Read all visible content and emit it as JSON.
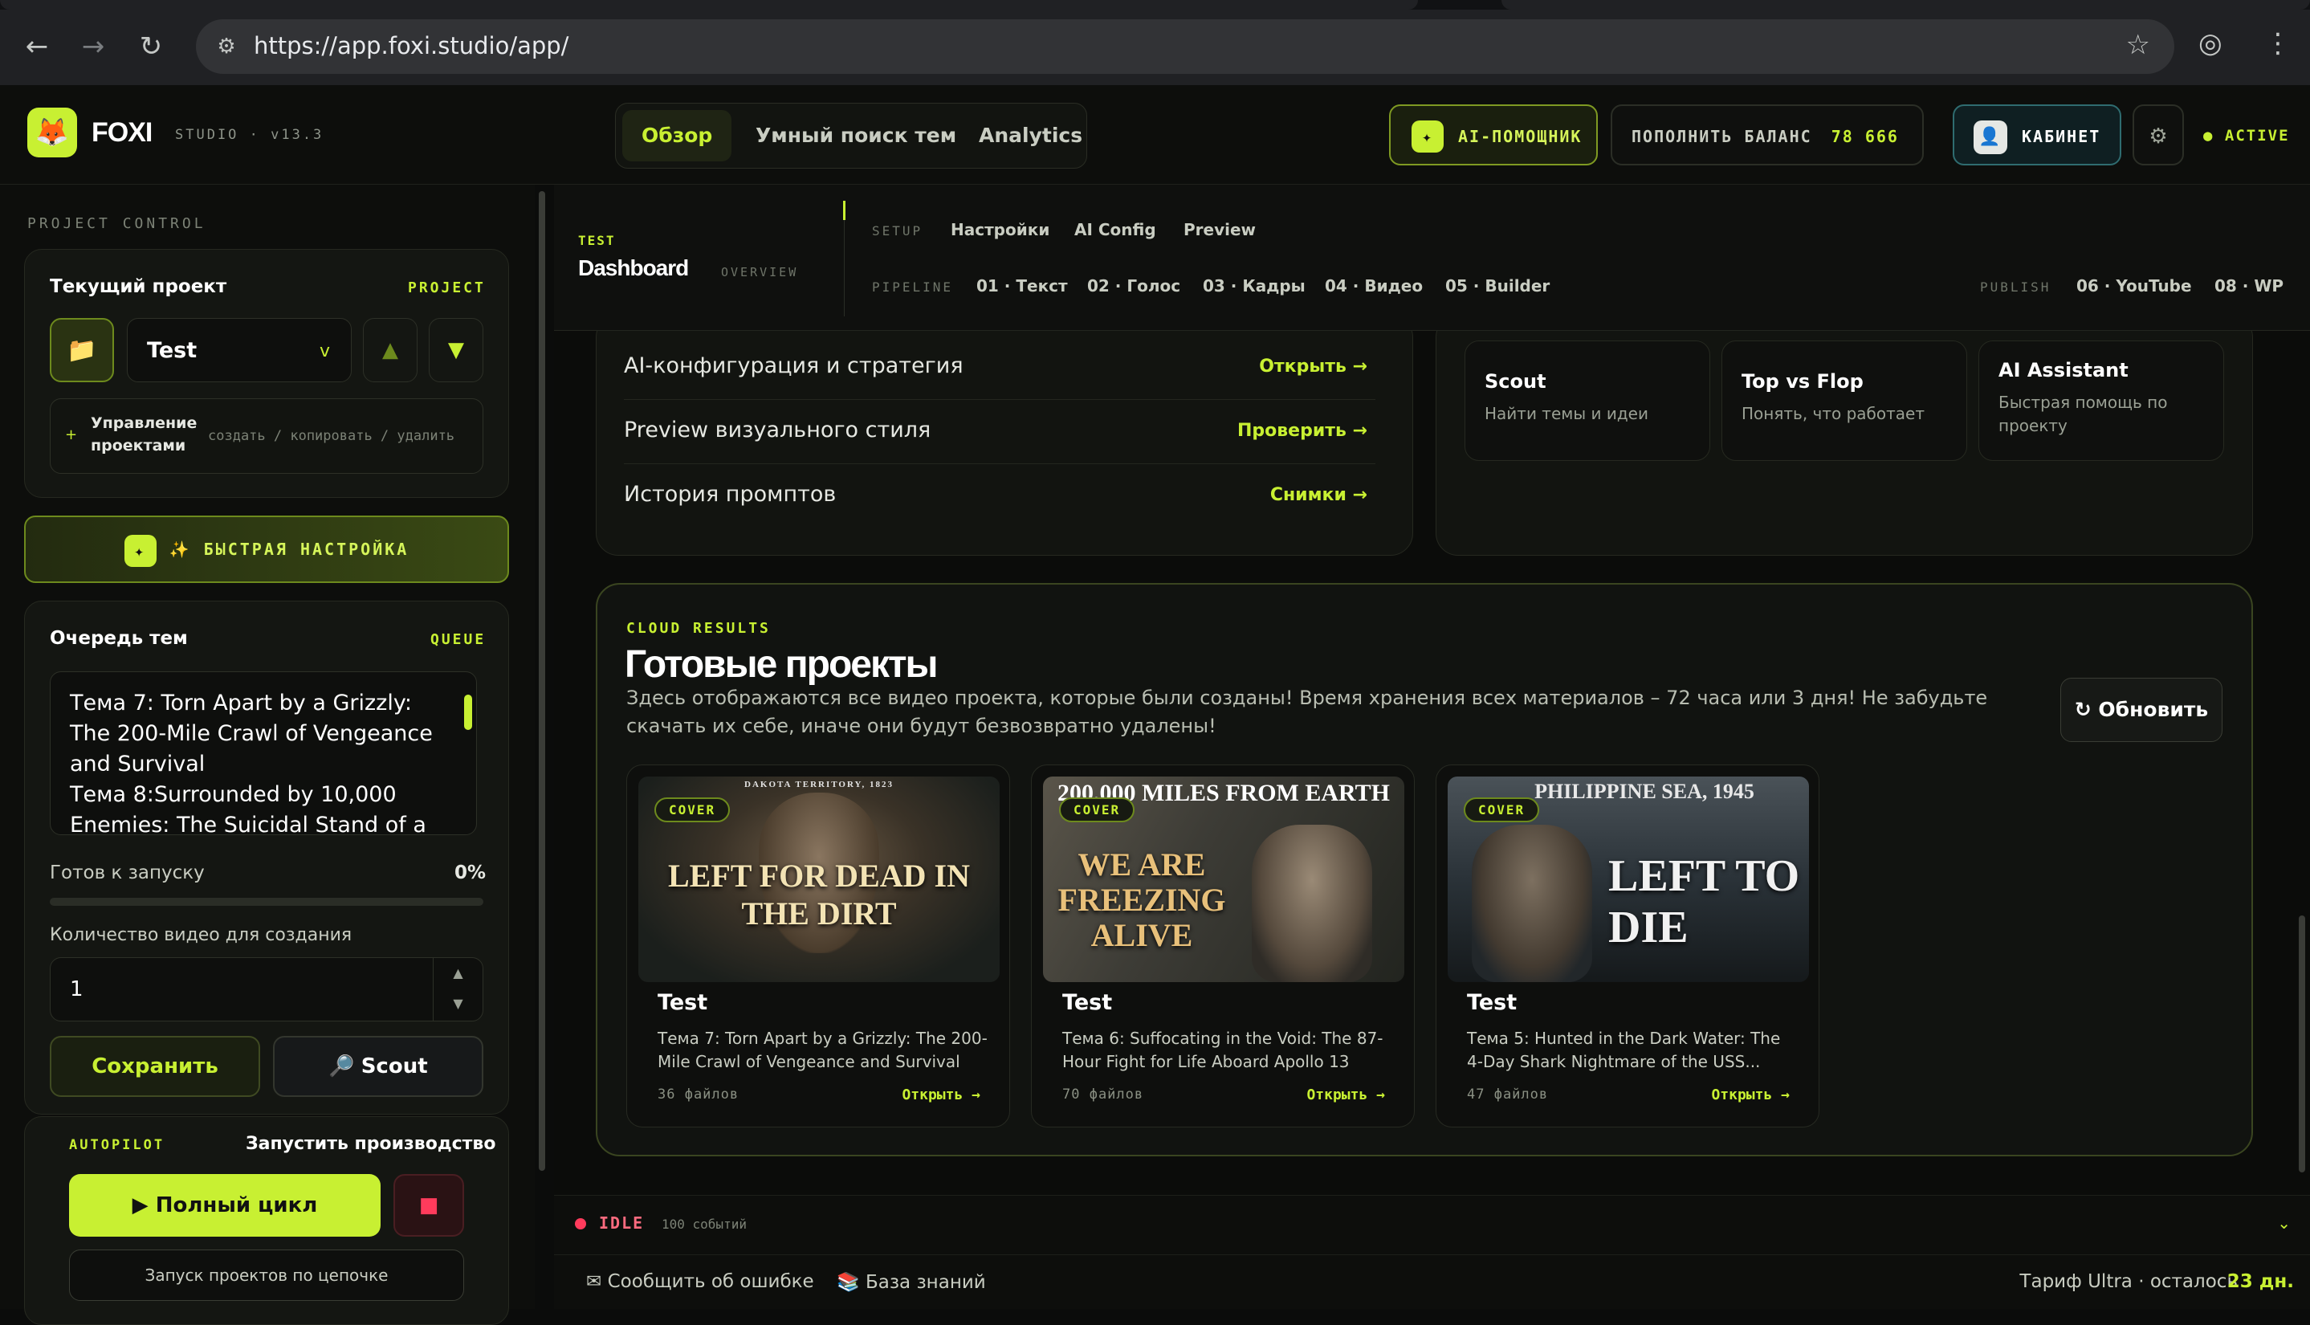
{
  "browser": {
    "url": "https://app.foxi.studio/app/"
  },
  "header": {
    "brand": "FOXI",
    "brand_sub": "STUDIO · v13.3",
    "nav_tabs": [
      {
        "label": "Обзор"
      },
      {
        "label": "Умный поиск тем"
      },
      {
        "label": "Analytics"
      }
    ],
    "ai_button": "AI-ПОМОЩНИК",
    "balance_label": "ПОПОЛНИТЬ БАЛАНС",
    "balance_value": "78 666 FX",
    "cabinet": "КАБИНЕТ",
    "status": "● ACTIVE",
    "accent_color": "#c8f032"
  },
  "sidebar": {
    "section_label": "PROJECT CONTROL",
    "current_project": {
      "title": "Текущий проект",
      "tag": "PROJECT",
      "selected": "Test",
      "manage_label": "Управление проектами",
      "manage_actions": "создать / копировать / удалить"
    },
    "quick_setup": "✨ БЫСТРАЯ НАСТРОЙКА",
    "queue": {
      "title": "Очередь тем",
      "tag": "QUEUE",
      "text": "Тема 7: Torn Apart by a Grizzly: The 200-Mile Crawl of Vengeance and Survival\nТема 8:Surrounded by 10,000 Enemies: The Suicidal Stand of a",
      "ready_label": "Готов к запуску",
      "ready_value": "0%",
      "progress": 0,
      "count_label": "Количество видео для создания",
      "count_value": "1",
      "save_button": "Сохранить",
      "scout_button": "Scout"
    },
    "autopilot": {
      "tag": "AUTOPILOT",
      "title": "Запустить производство",
      "full_cycle": "▶ Полный цикл",
      "chain_button": "Запуск проектов по цепочке"
    }
  },
  "subnav": {
    "project_label": "TEST",
    "title": "Dashboard",
    "title_sub": "OVERVIEW",
    "setup_label": "SETUP",
    "setup_items": [
      "Настройки",
      "AI Config",
      "Preview"
    ],
    "pipeline_label": "PIPELINE",
    "pipeline_items": [
      "01 · Текст",
      "02 · Голос",
      "03 · Кадры",
      "04 · Видео",
      "05 · Builder"
    ],
    "publish_label": "PUBLISH",
    "publish_items": [
      "06 · YouTube",
      "08 · WP"
    ]
  },
  "config_rows": [
    {
      "label": "AI-конфигурация и стратегия",
      "action": "Открыть →"
    },
    {
      "label": "Preview визуального стиля",
      "action": "Проверить →"
    },
    {
      "label": "История промптов",
      "action": "Снимки →"
    }
  ],
  "tools": [
    {
      "title": "Scout",
      "desc": "Найти темы и идеи"
    },
    {
      "title": "Top vs Flop",
      "desc": "Понять, что работает"
    },
    {
      "title": "AI Assistant",
      "desc": "Быстрая помощь по проекту"
    }
  ],
  "results": {
    "tag": "CLOUD RESULTS",
    "title": "Готовые проекты",
    "description": "Здесь отображаются все видео проекта, которые были созданы! Время хранения всех материалов – 72 часа или 3 дня! Не забудьте скачать их себе, иначе они будут безвозвратно удалены!",
    "refresh": "↻ Обновить",
    "projects": [
      {
        "badge": "COVER",
        "top_text": "DAKOTA TERRITORY, 1823",
        "headline": "LEFT FOR DEAD IN THE DIRT",
        "name": "Test",
        "desc": "Тема 7: Torn Apart by a Grizzly: The 200-Mile Crawl of Vengeance and Survival",
        "files": "36 файлов",
        "open": "Открыть →"
      },
      {
        "badge": "COVER",
        "top_text": "200,000 MILES FROM EARTH",
        "headline": "WE ARE FREEZING ALIVE",
        "name": "Test",
        "desc": "Тема 6: Suffocating in the Void: The 87-Hour Fight for Life Aboard Apollo 13",
        "files": "70 файлов",
        "open": "Открыть →"
      },
      {
        "badge": "COVER",
        "top_text": "PHILIPPINE SEA, 1945",
        "headline": "LEFT TO DIE",
        "name": "Test",
        "desc": "Тема 5: Hunted in the Dark Water: The 4-Day Shark Nightmare of the USS...",
        "files": "47 файлов",
        "open": "Открыть →"
      }
    ]
  },
  "statusbar": {
    "state": "IDLE",
    "events": "100 событий"
  },
  "footer": {
    "report": "✉ Сообщить об ошибке",
    "kb": "📚 База знаний",
    "plan": "Тариф Ultra · осталось",
    "days": "23 дн."
  }
}
